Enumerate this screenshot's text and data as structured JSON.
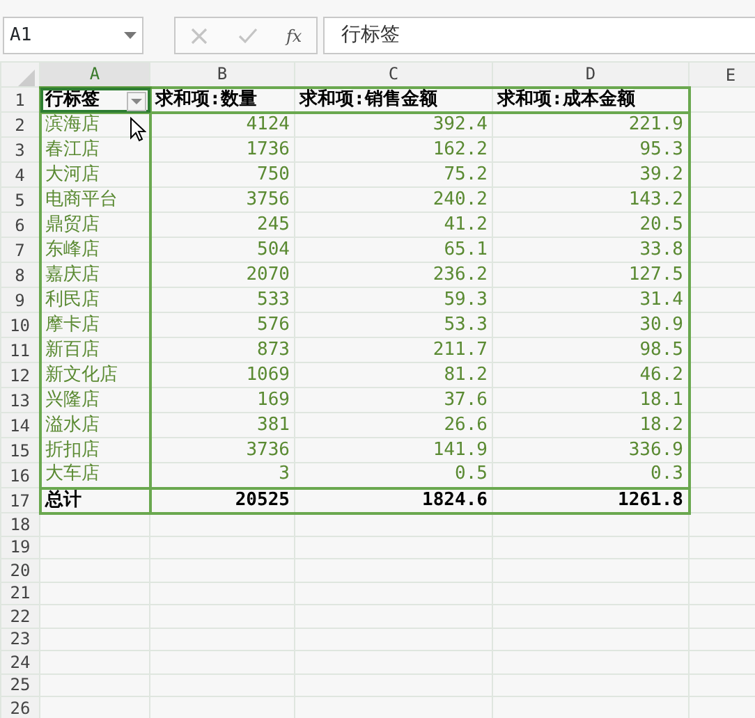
{
  "name_box": {
    "value": "A1"
  },
  "formula_bar": {
    "fx": "fx",
    "value": "行标签",
    "cancel_disabled": true,
    "confirm_disabled": true
  },
  "columns": [
    {
      "label": "A",
      "selected": true
    },
    {
      "label": "B",
      "selected": false
    },
    {
      "label": "C",
      "selected": false
    },
    {
      "label": "D",
      "selected": false
    },
    {
      "label": "E",
      "selected": false
    }
  ],
  "rows": [
    {
      "number": "1",
      "kind": "header",
      "cells": [
        "行标签",
        "求和项:数量",
        "求和项:销售金额",
        "求和项:成本金额"
      ],
      "filter": true
    },
    {
      "number": "2",
      "kind": "data",
      "cells": [
        "滨海店",
        "4124",
        "392.4",
        "221.9"
      ]
    },
    {
      "number": "3",
      "kind": "data",
      "cells": [
        "春江店",
        "1736",
        "162.2",
        "95.3"
      ]
    },
    {
      "number": "4",
      "kind": "data",
      "cells": [
        "大河店",
        "750",
        "75.2",
        "39.2"
      ]
    },
    {
      "number": "5",
      "kind": "data",
      "cells": [
        "电商平台",
        "3756",
        "240.2",
        "143.2"
      ]
    },
    {
      "number": "6",
      "kind": "data",
      "cells": [
        "鼎贸店",
        "245",
        "41.2",
        "20.5"
      ]
    },
    {
      "number": "7",
      "kind": "data",
      "cells": [
        "东峰店",
        "504",
        "65.1",
        "33.8"
      ]
    },
    {
      "number": "8",
      "kind": "data",
      "cells": [
        "嘉庆店",
        "2070",
        "236.2",
        "127.5"
      ]
    },
    {
      "number": "9",
      "kind": "data",
      "cells": [
        "利民店",
        "533",
        "59.3",
        "31.4"
      ]
    },
    {
      "number": "10",
      "kind": "data",
      "cells": [
        "摩卡店",
        "576",
        "53.3",
        "30.9"
      ]
    },
    {
      "number": "11",
      "kind": "data",
      "cells": [
        "新百店",
        "873",
        "211.7",
        "98.5"
      ]
    },
    {
      "number": "12",
      "kind": "data",
      "cells": [
        "新文化店",
        "1069",
        "81.2",
        "46.2"
      ]
    },
    {
      "number": "13",
      "kind": "data",
      "cells": [
        "兴隆店",
        "169",
        "37.6",
        "18.1"
      ]
    },
    {
      "number": "14",
      "kind": "data",
      "cells": [
        "溢水店",
        "381",
        "26.6",
        "18.2"
      ]
    },
    {
      "number": "15",
      "kind": "data",
      "cells": [
        "折扣店",
        "3736",
        "141.9",
        "336.9"
      ]
    },
    {
      "number": "16",
      "kind": "data",
      "cells": [
        "大车店",
        "3",
        "0.5",
        "0.3"
      ]
    },
    {
      "number": "17",
      "kind": "total",
      "cells": [
        "总计",
        "20525",
        "1824.6",
        "1261.8"
      ]
    },
    {
      "number": "18",
      "kind": "empty"
    },
    {
      "number": "19",
      "kind": "empty"
    },
    {
      "number": "20",
      "kind": "empty"
    },
    {
      "number": "21",
      "kind": "empty"
    },
    {
      "number": "22",
      "kind": "empty"
    },
    {
      "number": "23",
      "kind": "empty"
    },
    {
      "number": "24",
      "kind": "empty"
    },
    {
      "number": "25",
      "kind": "empty"
    },
    {
      "number": "26",
      "kind": "empty"
    }
  ]
}
